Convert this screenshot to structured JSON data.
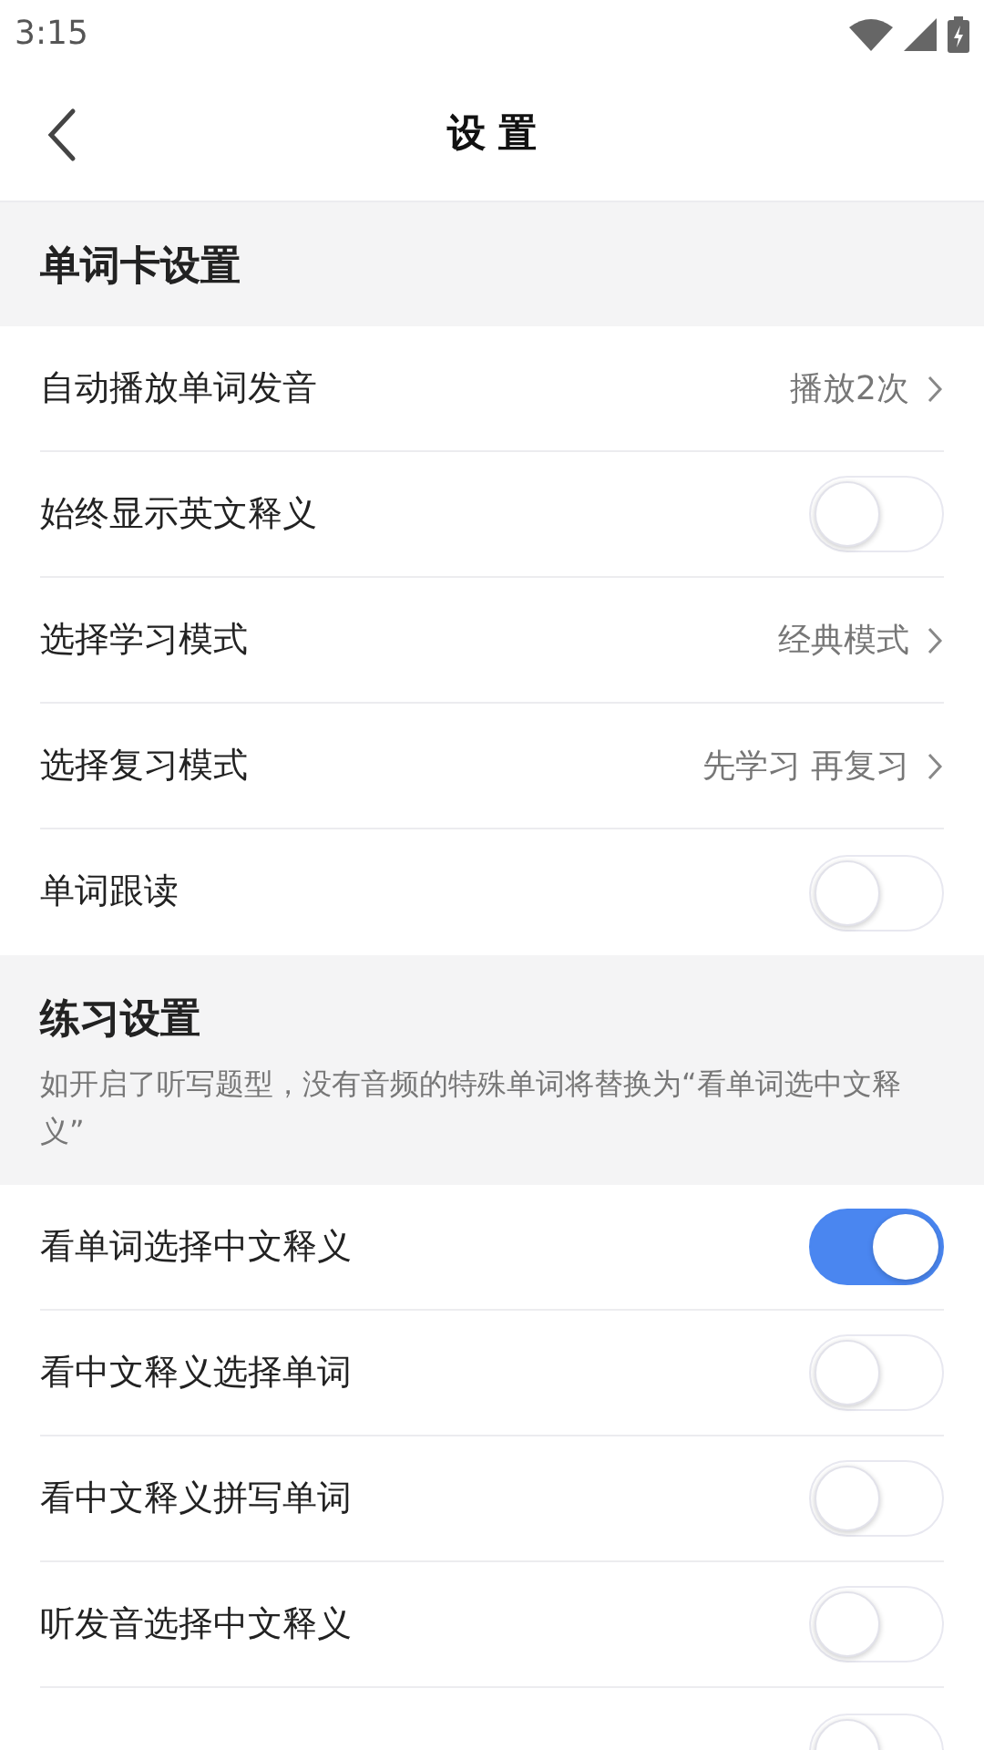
{
  "status_bar": {
    "time": "3:15"
  },
  "header": {
    "title": "设 置"
  },
  "sections": [
    {
      "title": "单词卡设置",
      "rows": [
        {
          "kind": "link",
          "label": "自动播放单词发音",
          "value": "播放2次"
        },
        {
          "kind": "toggle",
          "label": "始终显示英文释义",
          "on": false
        },
        {
          "kind": "link",
          "label": "选择学习模式",
          "value": "经典模式"
        },
        {
          "kind": "link",
          "label": "选择复习模式",
          "value": "先学习 再复习"
        },
        {
          "kind": "toggle",
          "label": "单词跟读",
          "on": false
        }
      ]
    },
    {
      "title": "练习设置",
      "description": "如开启了听写题型，没有音频的特殊单词将替换为“看单词选中文释义”",
      "rows": [
        {
          "kind": "toggle",
          "label": "看单词选择中文释义",
          "on": true
        },
        {
          "kind": "toggle",
          "label": "看中文释义选择单词",
          "on": false
        },
        {
          "kind": "toggle",
          "label": "看中文释义拼写单词",
          "on": false
        },
        {
          "kind": "toggle",
          "label": "听发音选择中文释义",
          "on": false
        },
        {
          "kind": "toggle",
          "on": false
        }
      ]
    }
  ]
}
